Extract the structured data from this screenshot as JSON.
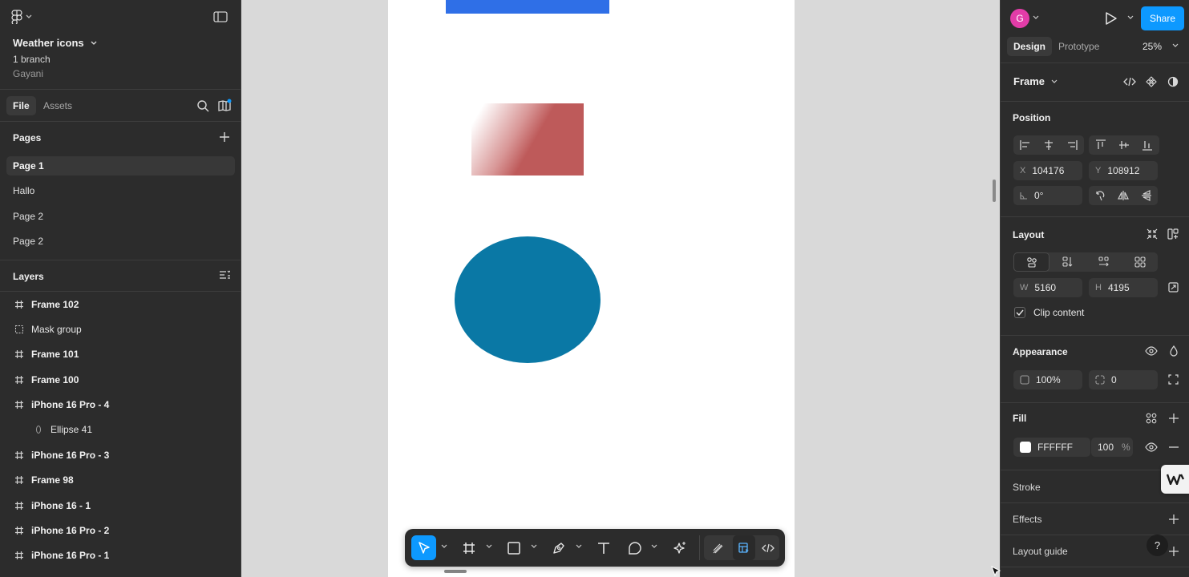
{
  "file": {
    "title": "Weather icons",
    "branch": "1 branch",
    "owner": "Gayani"
  },
  "left_tabs": {
    "file": "File",
    "assets": "Assets"
  },
  "pages": {
    "heading": "Pages",
    "items": [
      "Page 1",
      "Hallo",
      "Page 2",
      "Page 2"
    ]
  },
  "layers": {
    "heading": "Layers",
    "items": [
      {
        "name": "Frame 102",
        "icon": "frame-icon"
      },
      {
        "name": "Mask group",
        "icon": "mask-group-icon"
      },
      {
        "name": "Frame 101",
        "icon": "frame-icon"
      },
      {
        "name": "Frame 100",
        "icon": "frame-icon"
      },
      {
        "name": "iPhone 16 Pro - 4",
        "icon": "frame-icon"
      },
      {
        "name": "Ellipse 41",
        "icon": "ellipse-icon"
      },
      {
        "name": "iPhone 16 Pro - 3",
        "icon": "frame-icon"
      },
      {
        "name": "Frame 98",
        "icon": "frame-icon"
      },
      {
        "name": "iPhone 16 - 1",
        "icon": "frame-icon"
      },
      {
        "name": "iPhone 16 Pro - 2",
        "icon": "frame-icon"
      },
      {
        "name": "iPhone 16 Pro - 1",
        "icon": "frame-icon"
      }
    ]
  },
  "header": {
    "avatar_initial": "G",
    "share_label": "Share"
  },
  "right_tabs": {
    "design": "Design",
    "prototype": "Prototype"
  },
  "zoom": "25%",
  "inspector": {
    "selection_type": "Frame",
    "position": {
      "heading": "Position",
      "x_label": "X",
      "x": "104176",
      "y_label": "Y",
      "y": "108912",
      "rotation": "0°"
    },
    "layout": {
      "heading": "Layout",
      "w_label": "W",
      "w": "5160",
      "h_label": "H",
      "h": "4195",
      "clip_content": "Clip content"
    },
    "appearance": {
      "heading": "Appearance",
      "opacity": "100%",
      "corner_radius": "0"
    },
    "fill": {
      "heading": "Fill",
      "hex": "FFFFFF",
      "opacity": "100",
      "opacity_unit": "%"
    },
    "stroke": {
      "heading": "Stroke"
    },
    "effects": {
      "heading": "Effects"
    },
    "layout_guide": {
      "heading": "Layout guide"
    }
  },
  "help_label": "?",
  "colors": {
    "accent": "#0d99ff",
    "avatar": "#e23ca8",
    "canvas_blue_rect": "#2f6fe7",
    "canvas_gradient_rect": "#be5a5a",
    "canvas_ellipse": "#0a78a5"
  }
}
